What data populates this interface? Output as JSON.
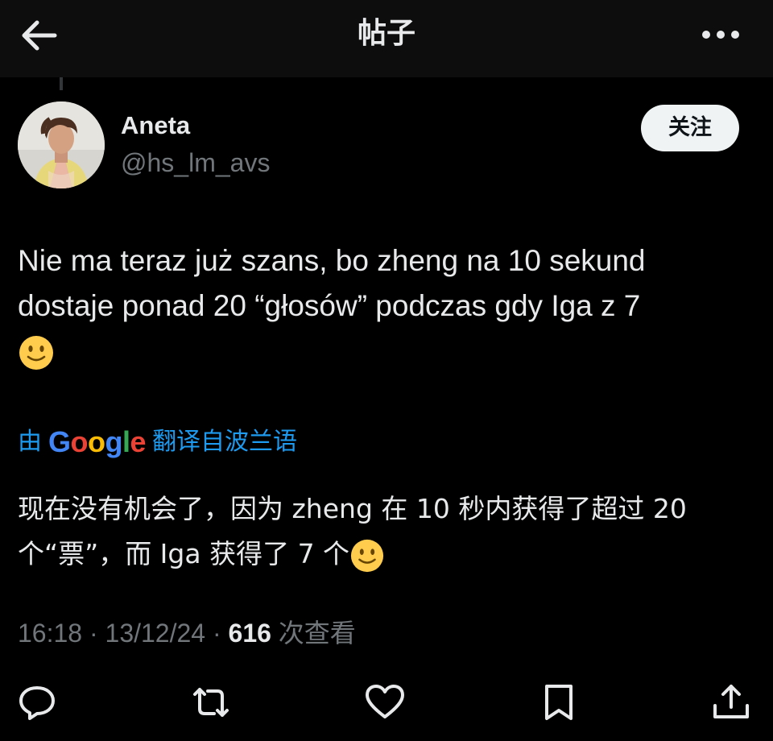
{
  "header": {
    "title": "帖子",
    "back_icon": "arrow-left-icon",
    "more_icon": "more-horizontal-icon"
  },
  "author": {
    "name": "Aneta",
    "handle": "@hs_lm_avs",
    "avatar": "avatar-photo",
    "follow_label": "关注"
  },
  "tweet": {
    "text_line1": "Nie ma teraz już szans, bo zheng na 10 sekund",
    "text_line2": "dostaje ponad 20 “głosów” podczas gdy Iga z 7",
    "emoji": "slightly-smiling-face-icon"
  },
  "translation": {
    "prefix": "由",
    "brand": [
      "G",
      "o",
      "o",
      "g",
      "l",
      "e"
    ],
    "brand_colors": [
      "#4285f4",
      "#ea4335",
      "#fbbc05",
      "#4285f4",
      "#34a853",
      "#ea4335"
    ],
    "suffix": "翻译自波兰语",
    "text_line1": "现在没有机会了，因为 zheng 在 10 秒内获得了超过 20",
    "text_line2": "个“票”，而 Iga 获得了 7 个"
  },
  "meta": {
    "time": "16:18",
    "sep1": " · ",
    "date": "13/12/24",
    "sep2": " · ",
    "views_count": "616",
    "views_label": " 次查看"
  },
  "actions": [
    "reply-icon",
    "retweet-icon",
    "like-icon",
    "bookmark-icon",
    "share-icon"
  ],
  "colors": {
    "background": "#000000",
    "accent": "#1d9bf0",
    "muted": "#71767b",
    "text": "#e7e9ea"
  }
}
